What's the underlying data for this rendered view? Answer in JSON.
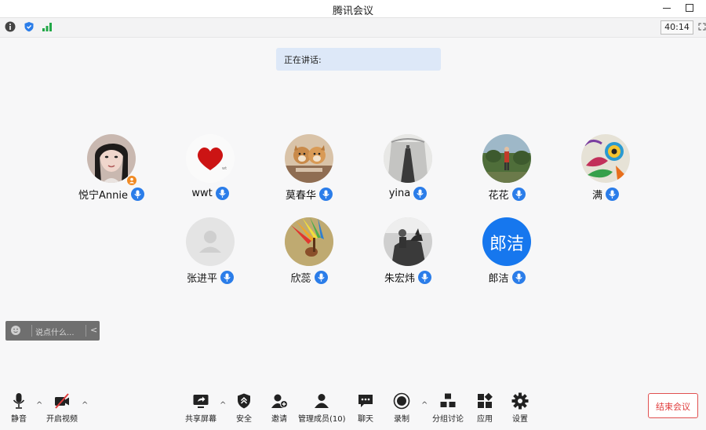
{
  "window": {
    "title": "腾讯会议"
  },
  "infobar": {
    "timer": "40:14"
  },
  "speaking": {
    "label": "正在讲话:"
  },
  "participants": [
    {
      "name": "悦宁Annie"
    },
    {
      "name": "wwt"
    },
    {
      "name": "莫春华"
    },
    {
      "name": "yina"
    },
    {
      "name": "花花"
    },
    {
      "name": "满"
    },
    {
      "name": "张进平"
    },
    {
      "name": "欣蕊"
    },
    {
      "name": "朱宏炜"
    },
    {
      "name": "郎洁",
      "avatar_text": "郎洁",
      "avatar_color": "#1677ee"
    }
  ],
  "chat": {
    "placeholder": "说点什么..."
  },
  "toolbar": {
    "mute": "静音",
    "video": "开启视频",
    "share": "共享屏幕",
    "security": "安全",
    "invite": "邀请",
    "members": "管理成员(10)",
    "chat": "聊天",
    "record": "录制",
    "breakout": "分组讨论",
    "apps": "应用",
    "settings": "设置",
    "end": "结束会议"
  },
  "colors": {
    "accent": "#2b7de9",
    "end": "#e03c3c"
  }
}
